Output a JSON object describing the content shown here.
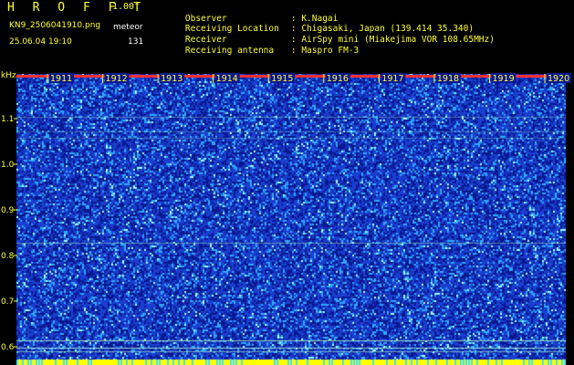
{
  "header": {
    "app_title": "H R O F F T",
    "version": "1.00f",
    "filename": "KN9_2506041910.png",
    "datetime": "25.06.04 19:10",
    "mode": "meteor",
    "count": "131",
    "info": [
      {
        "key": "Observer",
        "value": ": K.Nagai"
      },
      {
        "key": "Receiving Location",
        "value": ": Chigasaki, Japan (139.414 35.340)"
      },
      {
        "key": "Receiver",
        "value": ": AirSpy mini (Miakejima VOR 108.65MHz)"
      },
      {
        "key": "Receiving antenna",
        "value": ": Maspro FM-3"
      }
    ]
  },
  "plot": {
    "y_unit": "kHz",
    "y_ticks": [
      "1.1",
      "1.0",
      "0.9",
      "0.8",
      "0.7",
      "0.6"
    ],
    "time_ticks": [
      "1911",
      "1912",
      "1913",
      "1914",
      "1915",
      "1916",
      "1917",
      "1918",
      "1919",
      "1920"
    ],
    "colors": {
      "background": "#0a1890",
      "noise_low": "#1a3fd0",
      "noise_mid": "#2fa8ff",
      "noise_high": "#a0ffff",
      "axis_text": "#ffff33",
      "baseline": "#ffff00"
    }
  }
}
